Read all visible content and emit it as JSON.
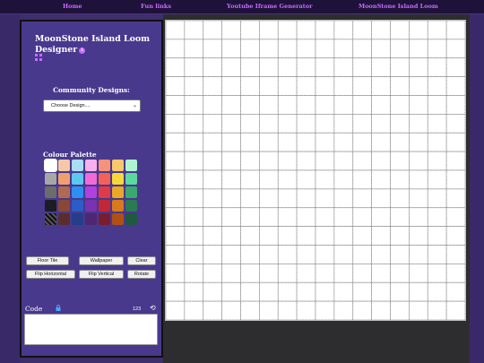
{
  "nav": {
    "items": [
      "Home",
      "Fun links",
      "Youtube Iframe Generator",
      "MoonStone Island Loom"
    ]
  },
  "sidebar": {
    "title": "MoonStone Island Loom Designer",
    "info_icon": "i",
    "community_label": "Community Designs:",
    "design_select_value": "Choose Design....",
    "palette_label": "Colour Palette",
    "palette": [
      "#ffffff",
      "#f6c8a6",
      "#a9def5",
      "#f6b0ec",
      "#f6927a",
      "#f7c96b",
      "#aef5d0",
      "#a7a7a7",
      "#f0a06e",
      "#5fc8f0",
      "#f06ad8",
      "#f36258",
      "#f4d83c",
      "#5cd9a0",
      "#6c6c6c",
      "#b06a54",
      "#2f8ff0",
      "#b040e0",
      "#e03a48",
      "#e8a82a",
      "#3ba870",
      "#1c1c24",
      "#8a4834",
      "#2c5cc8",
      "#7a32b0",
      "#c02838",
      "#d87a1c",
      "#2a7a52",
      "transparent",
      "#5a2c2c",
      "#243e8a",
      "#4e2672",
      "#7a1c30",
      "#b05014",
      "#1e5a3e"
    ],
    "buttons": [
      [
        "Floor Tile",
        "Wallpaper",
        "Clear"
      ],
      [
        "Flip Horizontal",
        "Flip Vertical",
        "Rotate"
      ]
    ],
    "code_label": "Code",
    "code_count": "123",
    "code_value": ""
  },
  "canvas": {
    "cols": 16,
    "rows": 16,
    "grid_color": "#8a8a8a",
    "fill": "#ffffff"
  }
}
